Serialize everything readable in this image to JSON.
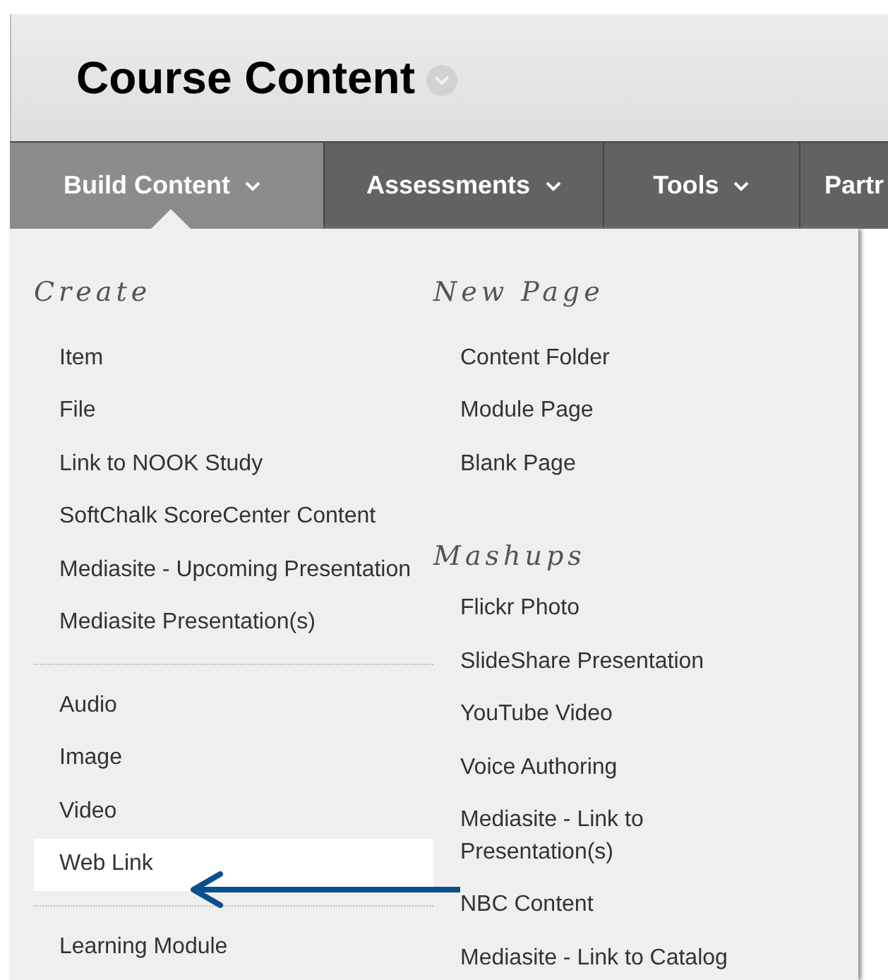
{
  "page_title": "Course Content",
  "nav_tabs": [
    {
      "label": "Build Content",
      "selected": true
    },
    {
      "label": "Assessments",
      "selected": false
    },
    {
      "label": "Tools",
      "selected": false
    },
    {
      "label": "Partr",
      "selected": false
    }
  ],
  "menu": {
    "left": {
      "heading": "Create",
      "groups": [
        [
          {
            "label": "Item",
            "selected": false
          },
          {
            "label": "File",
            "selected": false
          },
          {
            "label": "Link to NOOK Study",
            "selected": false
          },
          {
            "label": "SoftChalk ScoreCenter Content",
            "selected": false
          },
          {
            "label": "Mediasite - Upcoming Presentation",
            "selected": false
          },
          {
            "label": "Mediasite Presentation(s)",
            "selected": false
          }
        ],
        [
          {
            "label": "Audio",
            "selected": false
          },
          {
            "label": "Image",
            "selected": false
          },
          {
            "label": "Video",
            "selected": false
          },
          {
            "label": "Web Link",
            "selected": true
          }
        ],
        [
          {
            "label": "Learning Module",
            "selected": false
          }
        ]
      ]
    },
    "right": [
      {
        "heading": "New Page",
        "items": [
          {
            "label": "Content Folder",
            "selected": false
          },
          {
            "label": "Module Page",
            "selected": false
          },
          {
            "label": "Blank Page",
            "selected": false
          }
        ]
      },
      {
        "heading": "Mashups",
        "items": [
          {
            "label": "Flickr Photo",
            "selected": false
          },
          {
            "label": "SlideShare Presentation",
            "selected": false
          },
          {
            "label": "YouTube Video",
            "selected": false
          },
          {
            "label": "Voice Authoring",
            "selected": false
          },
          {
            "label": "Mediasite - Link to Presentation(s)",
            "selected": false
          },
          {
            "label": "NBC Content",
            "selected": false
          },
          {
            "label": "Mediasite - Link to Catalog",
            "selected": false
          }
        ]
      }
    ]
  }
}
